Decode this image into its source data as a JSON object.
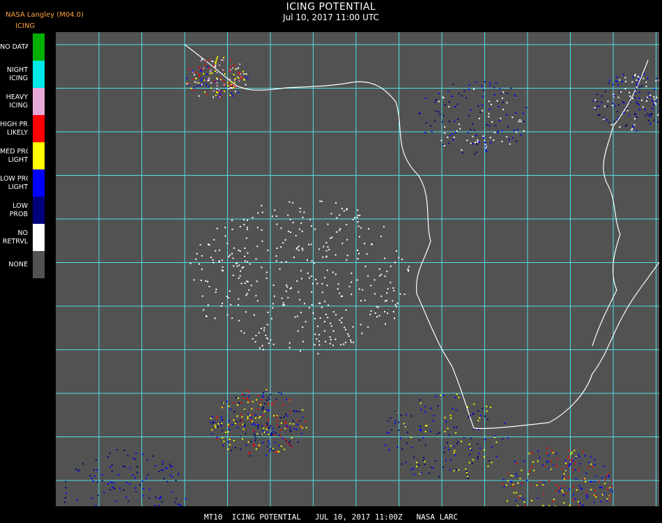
{
  "header": {
    "agency": "NASA Langley (M04.0)",
    "product": "ICING",
    "title": "ICING POTENTIAL",
    "time": "Jul 10, 2017 11:00 UTC"
  },
  "legend": [
    {
      "label": "NO DATA",
      "color": "#00b000"
    },
    {
      "label": "NIGHT\nICING",
      "color": "#00e8e8"
    },
    {
      "label": "HEAVY\nICING",
      "color": "#e6a8d6"
    },
    {
      "label": "HIGH PROB\nLIKELY",
      "color": "#ff0000"
    },
    {
      "label": "MED PROB\nLIGHT",
      "color": "#ffff00"
    },
    {
      "label": "LOW PROB\nLIGHT",
      "color": "#0000ff"
    },
    {
      "label": "LOW\nPROB",
      "color": "#00007a"
    },
    {
      "label": "NO\nRETRVL",
      "color": "#ffffff"
    },
    {
      "label": "NONE",
      "color": "#525252"
    }
  ],
  "map": {
    "background": "#525252",
    "grid_color": "#4fe0e8",
    "coast_color": "#ffffff",
    "label_color": "#ff3030"
  },
  "footer": "MT10  ICING POTENTIAL   JUL 10, 2017 11:00Z   NASA LARC"
}
